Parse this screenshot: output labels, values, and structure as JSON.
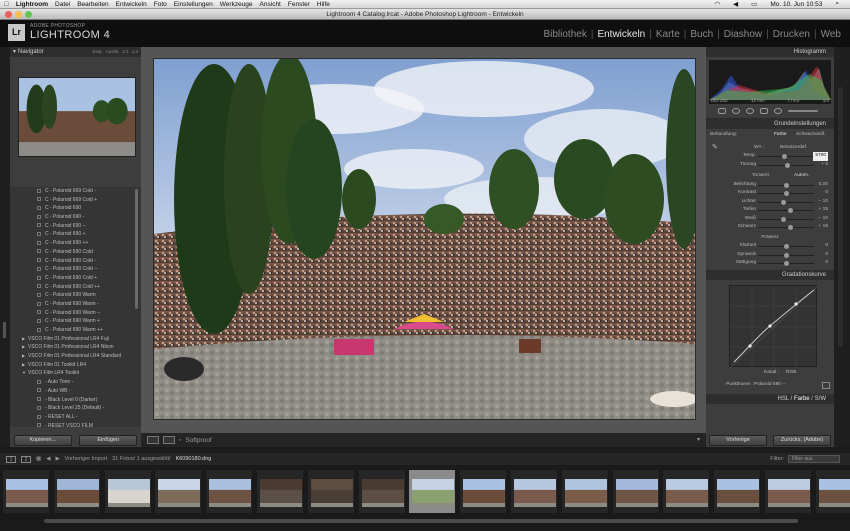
{
  "menubar": {
    "apple": "",
    "app": "Lightroom",
    "items": [
      "Datei",
      "Bearbeiten",
      "Entwickeln",
      "Foto",
      "Einstellungen",
      "Werkzeuge",
      "Ansicht",
      "Fenster",
      "Hilfe"
    ],
    "clock": "Mo. 10. Jun 10:53"
  },
  "window": {
    "title": "Lightroom 4 Catalog.lrcat - Adobe Photoshop Lightroom - Entwickeln"
  },
  "identity": {
    "logo": "Lr",
    "small": "ADOBE PHOTOSHOP",
    "name": "LIGHTROOM 4"
  },
  "modules": [
    "Bibliothek",
    "Entwickeln",
    "Karte",
    "Buch",
    "Diashow",
    "Drucken",
    "Web"
  ],
  "active_module": "Entwickeln",
  "navigator": {
    "title": "Navigator",
    "options": [
      "Einp.",
      "Ausfül.",
      "1:1",
      "1:4"
    ]
  },
  "presets": [
    {
      "label": "C - Polaroid 669 Cold -",
      "type": "preset"
    },
    {
      "label": "C - Polaroid 669 Cold +",
      "type": "preset"
    },
    {
      "label": "C - Polaroid 690",
      "type": "preset"
    },
    {
      "label": "C - Polaroid 690 -",
      "type": "preset"
    },
    {
      "label": "C - Polaroid 690 --",
      "type": "preset"
    },
    {
      "label": "C - Polaroid 690 +",
      "type": "preset"
    },
    {
      "label": "C - Polaroid 690 ++",
      "type": "preset"
    },
    {
      "label": "C - Polaroid 690 Cold",
      "type": "preset"
    },
    {
      "label": "C - Polaroid 690 Cold -",
      "type": "preset"
    },
    {
      "label": "C - Polaroid 690 Cold --",
      "type": "preset"
    },
    {
      "label": "C - Polaroid 690 Cold +",
      "type": "preset"
    },
    {
      "label": "C - Polaroid 690 Cold ++",
      "type": "preset"
    },
    {
      "label": "C - Polaroid 690 Warm",
      "type": "preset"
    },
    {
      "label": "C - Polaroid 690 Warm -",
      "type": "preset"
    },
    {
      "label": "C - Polaroid 690 Warm --",
      "type": "preset"
    },
    {
      "label": "C - Polaroid 690 Warm +",
      "type": "preset"
    },
    {
      "label": "C - Polaroid 690 Warm ++",
      "type": "preset"
    },
    {
      "label": "VSCO Film 01 Professional LR4 Fuji",
      "type": "folder"
    },
    {
      "label": "VSCO Film 01 Professional LR4 Nikon",
      "type": "folder"
    },
    {
      "label": "VSCO Film 01 Professional LR4 Standard",
      "type": "folder"
    },
    {
      "label": "VSCO Film 01 Toolkit LR4",
      "type": "folder"
    },
    {
      "label": "VSCO Film LR4 Toolkit",
      "type": "folder-open"
    },
    {
      "label": "- Auto Tone -",
      "type": "preset"
    },
    {
      "label": "- Auto WB -",
      "type": "preset"
    },
    {
      "label": "- Black Level 0 (Darker)",
      "type": "preset"
    },
    {
      "label": "- Black Level 25 (Default) -",
      "type": "preset"
    },
    {
      "label": "- RESET ALL -",
      "type": "preset"
    },
    {
      "label": "- RESET VSCO FILM",
      "type": "preset"
    }
  ],
  "left_buttons": {
    "copy": "Kopieren...",
    "paste": "Einfügen"
  },
  "toolbar": {
    "softproof": "Softproof"
  },
  "histogram": {
    "title": "Histogramm",
    "iso": "ISO 200",
    "focal": "12 mm",
    "aperture": "f / 9,0",
    "shutter": "1/4"
  },
  "basic": {
    "title": "Grundeinstellungen",
    "treatment_label": "Behandlung:",
    "treatment_color": "Farbe",
    "treatment_bw": "Schwarzweiß",
    "wb_label": "WA :",
    "wb_value": "Benutzerdef.",
    "tone_label": "Tonwert",
    "auto": "Autom.",
    "presence_label": "Präsenz",
    "sliders": [
      {
        "label": "Temp.",
        "value": "5700",
        "pos": 0.47
      },
      {
        "label": "Tönung",
        "value": "+ 5",
        "pos": 0.52
      },
      {
        "label": "Belichtung",
        "value": "0,00",
        "pos": 0.5
      },
      {
        "label": "Kontrast",
        "value": "0",
        "pos": 0.5
      },
      {
        "label": "Lichter",
        "value": "− 10",
        "pos": 0.45
      },
      {
        "label": "Tiefen",
        "value": "+ 15",
        "pos": 0.58
      },
      {
        "label": "Weiß",
        "value": "− 10",
        "pos": 0.45
      },
      {
        "label": "Schwarz",
        "value": "+ 15",
        "pos": 0.58
      },
      {
        "label": "Klarheit",
        "value": "0",
        "pos": 0.5
      },
      {
        "label": "Dynamik",
        "value": "0",
        "pos": 0.5
      },
      {
        "label": "Sättigung",
        "value": "0",
        "pos": 0.5
      }
    ]
  },
  "curve": {
    "title": "Gradationskurve",
    "channel_label": "Kanal :",
    "channel": "RGB",
    "pointcurve_label": "Punktkurve :",
    "pointcurve": "Polaroid 690 --"
  },
  "hsl": {
    "hsl": "HSL",
    "farbe": "Farbe",
    "sw": "S/W"
  },
  "right_buttons": {
    "prev": "Vorherige",
    "reset": "Zurücks. (Adobe)"
  },
  "filmstrip": {
    "pages": [
      "1",
      "2"
    ],
    "source": "Vorheriger Import",
    "count": "31 Fotos/ 1 ausgewählt/",
    "filename": "K6090180.dng",
    "filter_label": "Filter:",
    "filter_value": "Filter aus",
    "thumbs": 17,
    "selected": 8
  }
}
